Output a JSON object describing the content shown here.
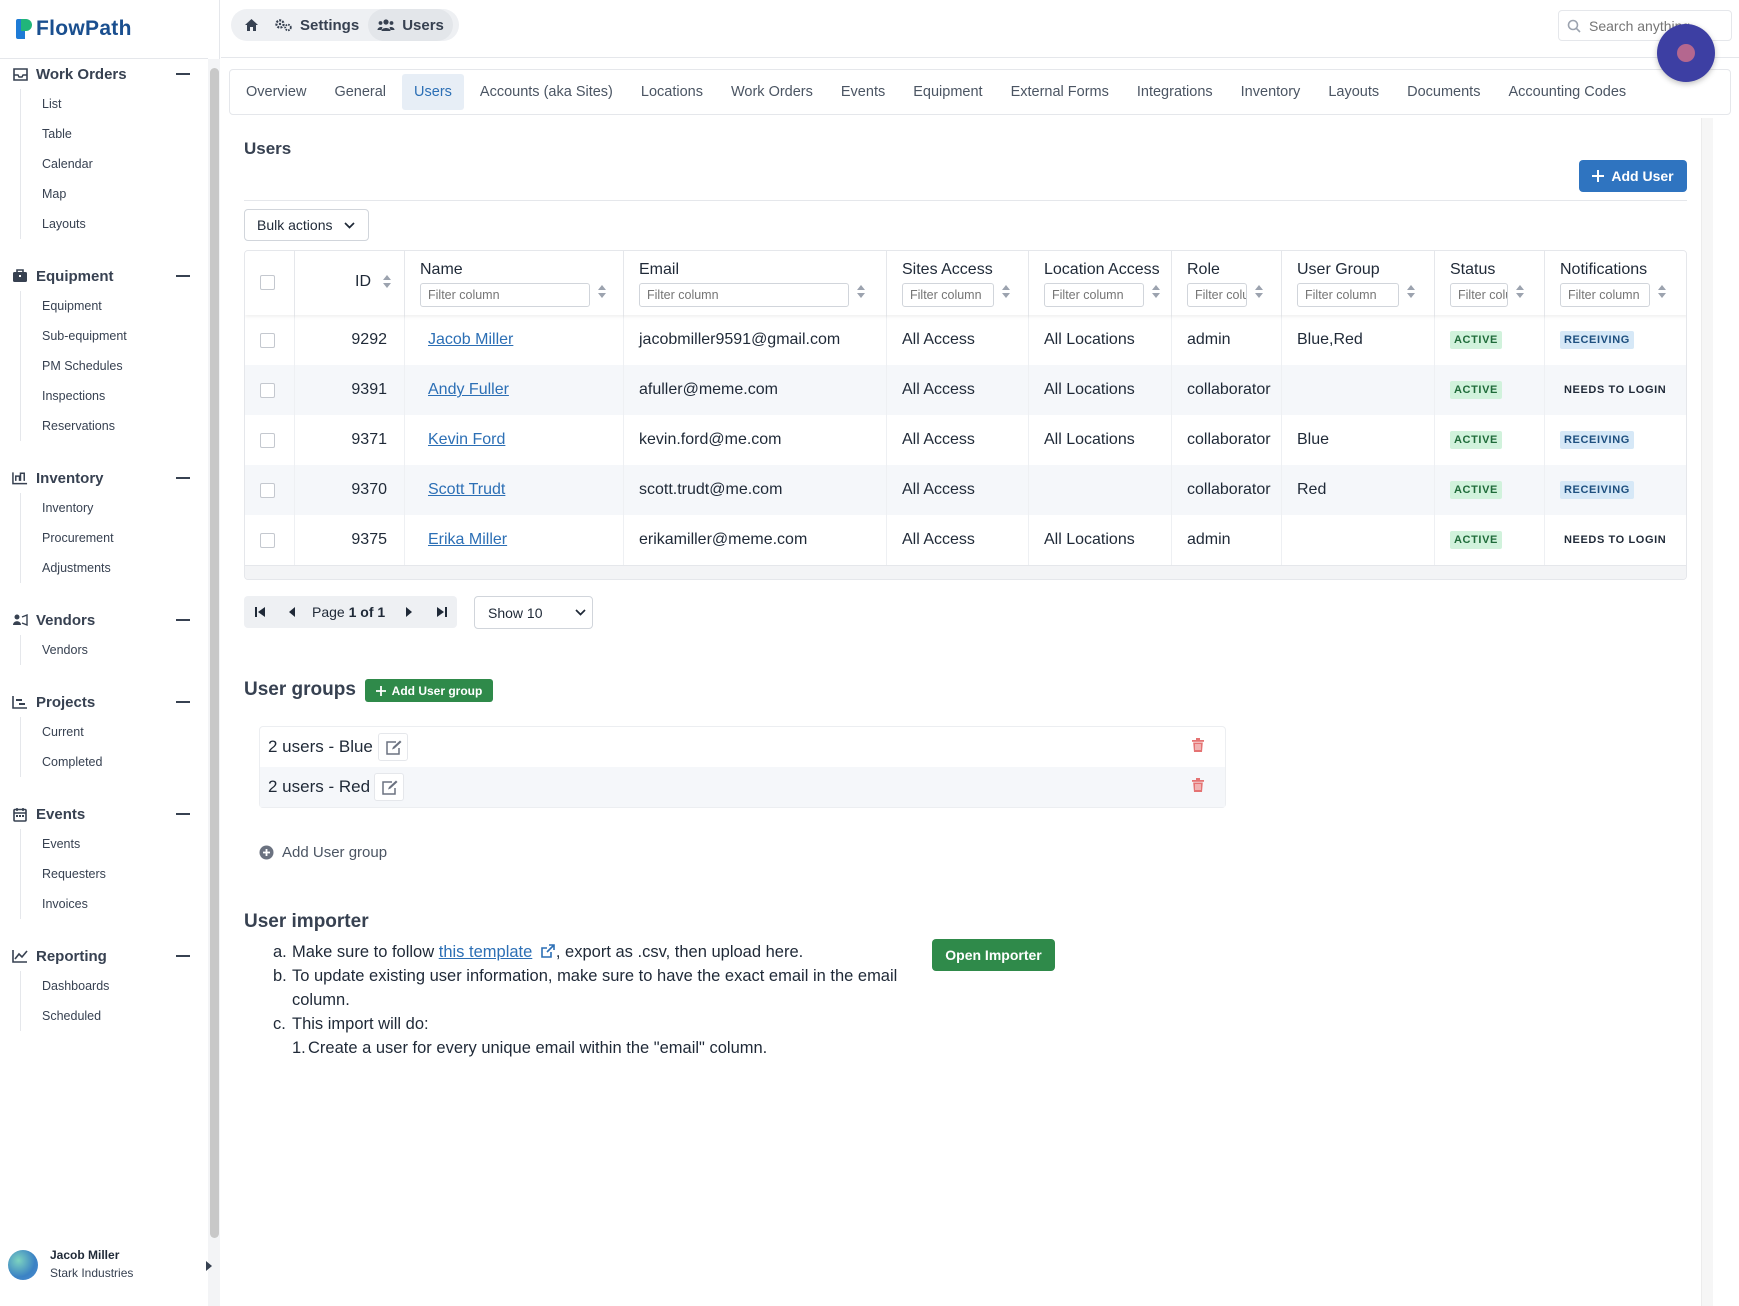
{
  "app": {
    "name": "FlowPath"
  },
  "sidebar": {
    "sections": [
      {
        "label": "Work Orders",
        "icon": "inbox-icon",
        "items": [
          "List",
          "Table",
          "Calendar",
          "Map",
          "Layouts"
        ]
      },
      {
        "label": "Equipment",
        "icon": "equipment-icon",
        "items": [
          "Equipment",
          "Sub-equipment",
          "PM Schedules",
          "Inspections",
          "Reservations"
        ]
      },
      {
        "label": "Inventory",
        "icon": "inventory-icon",
        "items": [
          "Inventory",
          "Procurement",
          "Adjustments"
        ]
      },
      {
        "label": "Vendors",
        "icon": "vendors-icon",
        "items": [
          "Vendors"
        ]
      },
      {
        "label": "Projects",
        "icon": "projects-icon",
        "items": [
          "Current",
          "Completed"
        ]
      },
      {
        "label": "Events",
        "icon": "calendar-icon",
        "items": [
          "Events",
          "Requesters",
          "Invoices"
        ]
      },
      {
        "label": "Reporting",
        "icon": "chart-icon",
        "items": [
          "Dashboards",
          "Scheduled"
        ]
      }
    ],
    "user": {
      "name": "Jacob Miller",
      "org": "Stark Industries"
    }
  },
  "topbar": {
    "breadcrumbs": [
      "Settings",
      "Users"
    ],
    "search_placeholder": "Search anything..."
  },
  "tabs": [
    "Overview",
    "General",
    "Users",
    "Accounts (aka Sites)",
    "Locations",
    "Work Orders",
    "Events",
    "Equipment",
    "External Forms",
    "Integrations",
    "Inventory",
    "Layouts",
    "Documents",
    "Accounting Codes"
  ],
  "active_tab": "Users",
  "users_section": {
    "title": "Users",
    "add_button": "Add User",
    "bulk_actions": "Bulk actions",
    "filter_placeholder": "Filter column",
    "columns": [
      "ID",
      "Name",
      "Email",
      "Sites Access",
      "Location Access",
      "Role",
      "User Group",
      "Status",
      "Notifications"
    ],
    "rows": [
      {
        "id": "9292",
        "name": "Jacob Miller",
        "email": "jacobmiller9591@gmail.com",
        "sites": "All Access",
        "locations": "All Locations",
        "role": "admin",
        "group": "Blue,Red",
        "status": "ACTIVE",
        "notifications": "RECEIVING"
      },
      {
        "id": "9391",
        "name": "Andy Fuller",
        "email": "afuller@meme.com",
        "sites": "All Access",
        "locations": "All Locations",
        "role": "collaborator",
        "group": "",
        "status": "ACTIVE",
        "notifications": "NEEDS TO LOGIN"
      },
      {
        "id": "9371",
        "name": "Kevin Ford",
        "email": "kevin.ford@me.com",
        "sites": "All Access",
        "locations": "All Locations",
        "role": "collaborator",
        "group": "Blue",
        "status": "ACTIVE",
        "notifications": "RECEIVING"
      },
      {
        "id": "9370",
        "name": "Scott Trudt",
        "email": "scott.trudt@me.com",
        "sites": "All Access",
        "locations": "",
        "role": "collaborator",
        "group": "Red",
        "status": "ACTIVE",
        "notifications": "RECEIVING"
      },
      {
        "id": "9375",
        "name": "Erika Miller",
        "email": "erikamiller@meme.com",
        "sites": "All Access",
        "locations": "All Locations",
        "role": "admin",
        "group": "",
        "status": "ACTIVE",
        "notifications": "NEEDS TO LOGIN"
      }
    ],
    "pagination": {
      "page_label": "Page",
      "current": "1",
      "of_label": "of",
      "total": "1",
      "show": "Show 10"
    }
  },
  "user_groups": {
    "title": "User groups",
    "add_button": "Add User group",
    "groups": [
      "2 users - Blue",
      "2 users - Red"
    ],
    "add_link": "Add User group"
  },
  "importer": {
    "title": "User importer",
    "a_prefix": "Make sure to follow",
    "a_link": "this template",
    "a_suffix": ", export as .csv, then upload here.",
    "b": "To update existing user information, make sure to have the exact email in the email column.",
    "c": "This import will do:",
    "c1": "Create a user for every unique email within the \"email\" column.",
    "button": "Open Importer"
  },
  "colors": {
    "primary": "#2f74c0",
    "success": "#2f8a4a",
    "brand": "#1a4f8f",
    "fab": "#3d3fa3"
  }
}
